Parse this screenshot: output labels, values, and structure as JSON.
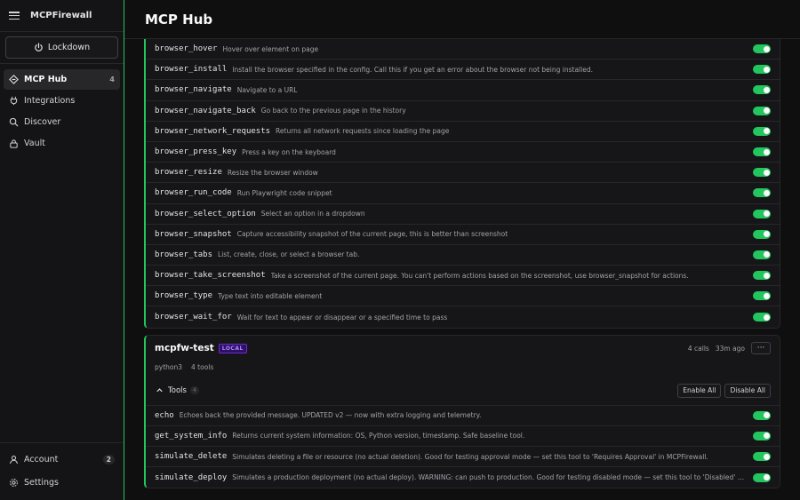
{
  "sidebar": {
    "app_title": "MCPFirewall",
    "lockdown_label": "Lockdown",
    "items": [
      {
        "label": "MCP Hub",
        "count": "4",
        "icon": "hub-icon"
      },
      {
        "label": "Integrations",
        "icon": "plug-icon"
      },
      {
        "label": "Discover",
        "icon": "search-icon"
      },
      {
        "label": "Vault",
        "icon": "lock-icon"
      }
    ],
    "bottom": [
      {
        "label": "Account",
        "badge": "2",
        "icon": "user-icon"
      },
      {
        "label": "Settings",
        "icon": "gear-icon"
      }
    ]
  },
  "header": {
    "title": "MCP Hub"
  },
  "playwright_tools": [
    {
      "name": "browser_hover",
      "desc": "Hover over element on page",
      "enabled": true
    },
    {
      "name": "browser_install",
      "desc": "Install the browser specified in the config. Call this if you get an error about the browser not being installed.",
      "enabled": true
    },
    {
      "name": "browser_navigate",
      "desc": "Navigate to a URL",
      "enabled": true
    },
    {
      "name": "browser_navigate_back",
      "desc": "Go back to the previous page in the history",
      "enabled": true
    },
    {
      "name": "browser_network_requests",
      "desc": "Returns all network requests since loading the page",
      "enabled": true
    },
    {
      "name": "browser_press_key",
      "desc": "Press a key on the keyboard",
      "enabled": true
    },
    {
      "name": "browser_resize",
      "desc": "Resize the browser window",
      "enabled": true
    },
    {
      "name": "browser_run_code",
      "desc": "Run Playwright code snippet",
      "enabled": true
    },
    {
      "name": "browser_select_option",
      "desc": "Select an option in a dropdown",
      "enabled": true
    },
    {
      "name": "browser_snapshot",
      "desc": "Capture accessibility snapshot of the current page, this is better than screenshot",
      "enabled": true
    },
    {
      "name": "browser_tabs",
      "desc": "List, create, close, or select a browser tab.",
      "enabled": true
    },
    {
      "name": "browser_take_screenshot",
      "desc": "Take a screenshot of the current page. You can't perform actions based on the screenshot, use browser_snapshot for actions.",
      "enabled": true
    },
    {
      "name": "browser_type",
      "desc": "Type text into editable element",
      "enabled": true
    },
    {
      "name": "browser_wait_for",
      "desc": "Wait for text to appear or disappear or a specified time to pass",
      "enabled": true
    }
  ],
  "server": {
    "name": "mcpfw-test",
    "badge": "LOCAL",
    "calls": "4 calls",
    "last_used": "33m ago",
    "runtime": "python3",
    "tools_count": "4 tools",
    "tools_label": "Tools",
    "tools_badge": "4",
    "enable_all": "Enable All",
    "disable_all": "Disable All",
    "tools": [
      {
        "name": "echo",
        "desc": "Echoes back the provided message. UPDATED v2 — now with extra logging and telemetry.",
        "enabled": true
      },
      {
        "name": "get_system_info",
        "desc": "Returns current system information: OS, Python version, timestamp. Safe baseline tool.",
        "enabled": true
      },
      {
        "name": "simulate_delete",
        "desc": "Simulates deleting a file or resource (no actual deletion). Good for testing approval mode — set this tool to 'Requires Approval' in MCPFirewall.",
        "enabled": true
      },
      {
        "name": "simulate_deploy",
        "desc": "Simulates a production deployment (no actual deploy). WARNING: can push to production. Good for testing disabled mode — set this tool to 'Disabled' in MCPFirewall.",
        "enabled": true
      }
    ]
  },
  "colors": {
    "accent": "#22c55e",
    "local_badge": "#a78bfa"
  }
}
